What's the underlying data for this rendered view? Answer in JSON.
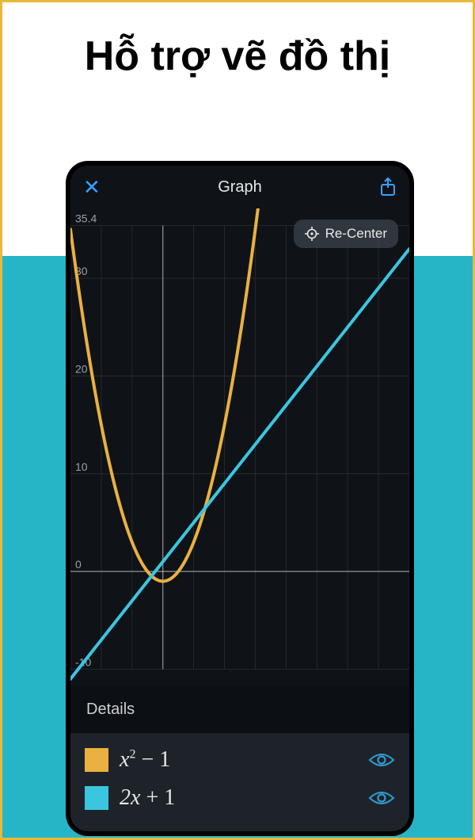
{
  "promo_title": "Hỗ trợ vẽ đồ thị",
  "topbar": {
    "close_glyph": "✕",
    "title": "Graph"
  },
  "recenter_label": "Re-Center",
  "details_label": "Details",
  "colors": {
    "series1": "#eab041",
    "series2": "#3bc6e0",
    "grid": "#4a4f55",
    "axis": "#c3c3c3",
    "tick_text": "#9aa0a6",
    "eye": "#2f98c9"
  },
  "legend": [
    {
      "swatch": "#eab041",
      "var": "x",
      "sup": "2",
      "rest": " − 1"
    },
    {
      "swatch": "#3bc6e0",
      "var": "2x",
      "sup": "",
      "rest": " + 1"
    }
  ],
  "chart_data": {
    "type": "line",
    "xlim": [
      -6,
      16
    ],
    "ylim": [
      -10,
      35.4
    ],
    "y_ticks": [
      -10,
      0,
      10,
      20,
      30,
      35.4
    ],
    "x_ticks_major": [
      0
    ],
    "series": [
      {
        "name": "x^2 - 1",
        "color": "#eab041",
        "fn": "parabola",
        "a": 1,
        "b": 0,
        "c": -1
      },
      {
        "name": "2x + 1",
        "color": "#3bc6e0",
        "fn": "line",
        "m": 2,
        "k": 1
      }
    ]
  }
}
